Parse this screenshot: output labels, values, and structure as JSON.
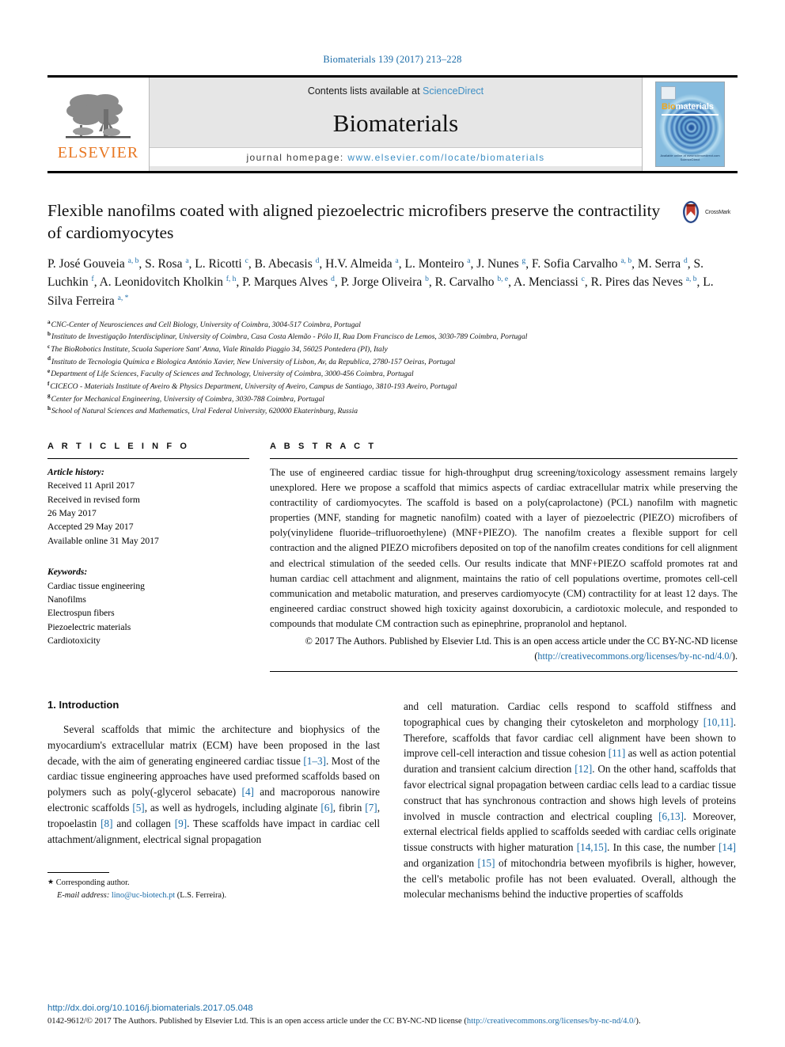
{
  "running_head": "Biomaterials 139 (2017) 213–228",
  "masthead": {
    "publisher": "ELSEVIER",
    "contents_prefix": "Contents lists available at ",
    "contents_link": "ScienceDirect",
    "journal_name": "Biomaterials",
    "homepage_prefix": "journal homepage: ",
    "homepage_url": "www.elsevier.com/locate/biomaterials",
    "cover": {
      "title_part1": "Bio",
      "title_part2": "materials",
      "footer_line1": "Available online at www.sciencedirect.com",
      "footer_line2": "ScienceDirect"
    }
  },
  "title": "Flexible nanofilms coated with aligned piezoelectric microfibers preserve the contractility of cardiomyocytes",
  "crossmark": {
    "label": "CrossMark"
  },
  "authors_html": "P. José Gouveia <sup>a, b</sup>, S. Rosa <sup>a</sup>, L. Ricotti <sup>c</sup>, B. Abecasis <sup>d</sup>, H.V. Almeida <sup>a</sup>, L. Monteiro <sup>a</sup>, J. Nunes <sup>g</sup>, F. Sofia Carvalho <sup>a, b</sup>, M. Serra <sup>d</sup>, S. Luchkin <sup>f</sup>, A. Leonidovitch Kholkin <sup>f, h</sup>, P. Marques Alves <sup>d</sup>, P. Jorge Oliveira <sup>b</sup>, R. Carvalho <sup>b, e</sup>, A. Menciassi <sup>c</sup>, R. Pires das Neves <sup>a, b</sup>, L. Silva Ferreira <sup>a, *</sup>",
  "affiliations": [
    {
      "marker": "a",
      "text": "CNC-Center of Neurosciences and Cell Biology, University of Coimbra, 3004-517 Coimbra, Portugal"
    },
    {
      "marker": "b",
      "text": "Instituto de Investigação Interdisciplinar, University of Coimbra, Casa Costa Alemão - Pólo II, Rua Dom Francisco de Lemos, 3030-789 Coimbra, Portugal"
    },
    {
      "marker": "c",
      "text": "The BioRobotics Institute, Scuola Superiore Sant' Anna, Viale Rinaldo Piaggio 34, 56025 Pontedera (PI), Italy"
    },
    {
      "marker": "d",
      "text": "Instituto de Tecnologia Química e Biologica António Xavier, New University of Lisbon, Av, da Republica, 2780-157 Oeiras, Portugal"
    },
    {
      "marker": "e",
      "text": "Department of Life Sciences, Faculty of Sciences and Technology, University of Coimbra, 3000-456 Coimbra, Portugal"
    },
    {
      "marker": "f",
      "text": "CICECO - Materials Institute of Aveiro & Physics Department, University of Aveiro, Campus de Santiago, 3810-193 Aveiro, Portugal"
    },
    {
      "marker": "g",
      "text": "Center for Mechanical Engineering, University of Coimbra, 3030-788 Coimbra, Portugal"
    },
    {
      "marker": "h",
      "text": "School of Natural Sciences and Mathematics, Ural Federal University, 620000 Ekaterinburg, Russia"
    }
  ],
  "article_info": {
    "heading": "A R T I C L E   I N F O",
    "history_label": "Article history:",
    "history": [
      "Received 11 April 2017",
      "Received in revised form",
      "26 May 2017",
      "Accepted 29 May 2017",
      "Available online 31 May 2017"
    ],
    "keywords_label": "Keywords:",
    "keywords": [
      "Cardiac tissue engineering",
      "Nanofilms",
      "Electrospun fibers",
      "Piezoelectric materials",
      "Cardiotoxicity"
    ]
  },
  "abstract": {
    "heading": "A B S T R A C T",
    "text": "The use of engineered cardiac tissue for high-throughput drug screening/toxicology assessment remains largely unexplored. Here we propose a scaffold that mimics aspects of cardiac extracellular matrix while preserving the contractility of cardiomyocytes. The scaffold is based on a poly(caprolactone) (PCL) nanofilm with magnetic properties (MNF, standing for magnetic nanofilm) coated with a layer of piezoelectric (PIEZO) microfibers of poly(vinylidene fluoride–trifluoroethylene) (MNF+PIEZO). The nanofilm creates a flexible support for cell contraction and the aligned PIEZO microfibers deposited on top of the nanofilm creates conditions for cell alignment and electrical stimulation of the seeded cells. Our results indicate that MNF+PIEZO scaffold promotes rat and human cardiac cell attachment and alignment, maintains the ratio of cell populations overtime, promotes cell-cell communication and metabolic maturation, and preserves cardiomyocyte (CM) contractility for at least 12 days. The engineered cardiac construct showed high toxicity against doxorubicin, a cardiotoxic molecule, and responded to compounds that modulate CM contraction such as epinephrine, propranolol and heptanol.",
    "copyright_text": "© 2017 The Authors. Published by Elsevier Ltd. This is an open access article under the CC BY-NC-ND license (",
    "copyright_url": "http://creativecommons.org/licenses/by-nc-nd/4.0/",
    "copyright_tail": ")."
  },
  "introduction": {
    "number_title": "1.  Introduction",
    "left_column_html": "Several scaffolds that mimic the architecture and biophysics of the myocardium's extracellular matrix (ECM) have been proposed in the last decade, with the aim of generating engineered cardiac tissue <span class=\"ref\">[1–3]</span>. Most of the cardiac tissue engineering approaches have used preformed scaffolds based on polymers such as poly(-glycerol sebacate) <span class=\"ref\">[4]</span> and macroporous nanowire electronic scaffolds <span class=\"ref\">[5]</span>, as well as hydrogels, including alginate <span class=\"ref\">[6]</span>, fibrin <span class=\"ref\">[7]</span>, tropoelastin <span class=\"ref\">[8]</span> and collagen <span class=\"ref\">[9]</span>. These scaffolds have impact in cardiac cell attachment/alignment, electrical signal propagation",
    "right_column_html": "and cell maturation. Cardiac cells respond to scaffold stiffness and topographical cues by changing their cytoskeleton and morphology <span class=\"ref\">[10,11]</span>. Therefore, scaffolds that favor cardiac cell alignment have been shown to improve cell-cell interaction and tissue cohesion <span class=\"ref\">[11]</span> as well as action potential duration and transient calcium direction <span class=\"ref\">[12]</span>. On the other hand, scaffolds that favor electrical signal propagation between cardiac cells lead to a cardiac tissue construct that has synchronous contraction and shows high levels of proteins involved in muscle contraction and electrical coupling <span class=\"ref\">[6,13]</span>. Moreover, external electrical fields applied to scaffolds seeded with cardiac cells originate tissue constructs with higher maturation <span class=\"ref\">[14,15]</span>. In this case, the number <span class=\"ref\">[14]</span> and organization <span class=\"ref\">[15]</span> of mitochondria between myofibrils is higher, however, the cell's metabolic profile has not been evaluated. Overall, although the molecular mechanisms behind the inductive properties of scaffolds"
  },
  "footnote": {
    "corresponding": "Corresponding author.",
    "email_label": "E-mail address:",
    "email": "lino@uc-biotech.pt",
    "email_owner": "(L.S. Ferreira)."
  },
  "page_footer": {
    "doi": "http://dx.doi.org/10.1016/j.biomaterials.2017.05.048",
    "issn_prefix": "0142-9612/© 2017 The Authors. Published by Elsevier Ltd. This is an open access article under the CC BY-NC-ND license (",
    "issn_url": "http://creativecommons.org/licenses/by-nc-nd/4.0/",
    "issn_tail": ")."
  },
  "colors": {
    "link_blue": "#1b6ca8",
    "elsevier_orange": "#e87722",
    "masthead_grey": "#e6e6e6"
  }
}
